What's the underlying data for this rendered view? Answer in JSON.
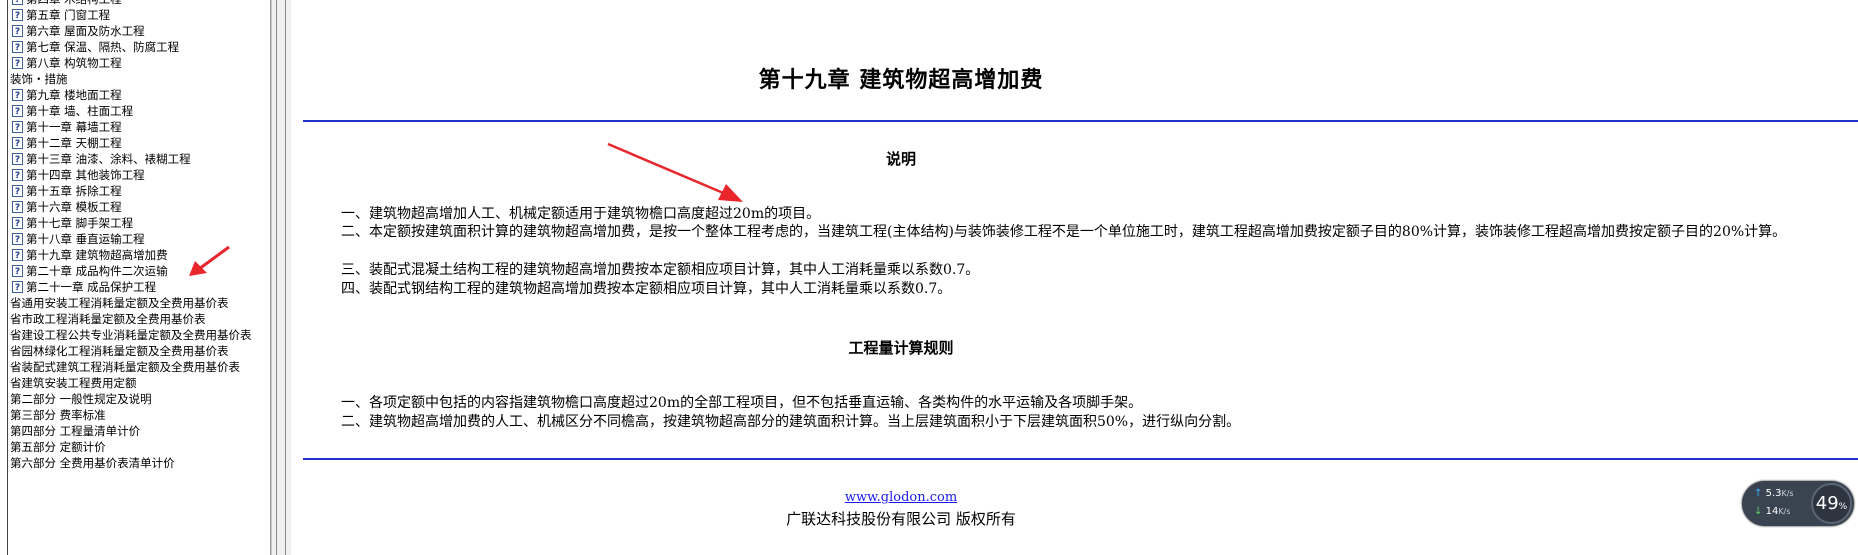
{
  "tree": [
    {
      "type": "doc",
      "label": "第四章  木结构工程"
    },
    {
      "type": "doc",
      "label": "第五章  门窗工程"
    },
    {
      "type": "doc",
      "label": "第六章  屋面及防水工程"
    },
    {
      "type": "doc",
      "label": "第七章  保温、隔热、防腐工程"
    },
    {
      "type": "doc",
      "label": "第八章  构筑物工程"
    },
    {
      "type": "cat",
      "label": "装饰・措施"
    },
    {
      "type": "doc",
      "label": "第九章  楼地面工程"
    },
    {
      "type": "doc",
      "label": "第十章  墙、柱面工程"
    },
    {
      "type": "doc",
      "label": "第十一章  幕墙工程"
    },
    {
      "type": "doc",
      "label": "第十二章  天棚工程"
    },
    {
      "type": "doc",
      "label": "第十三章  油漆、涂料、裱糊工程"
    },
    {
      "type": "doc",
      "label": "第十四章  其他装饰工程"
    },
    {
      "type": "doc",
      "label": "第十五章  拆除工程"
    },
    {
      "type": "doc",
      "label": "第十六章  模板工程"
    },
    {
      "type": "doc",
      "label": "第十七章  脚手架工程"
    },
    {
      "type": "doc",
      "label": "第十八章  垂直运输工程"
    },
    {
      "type": "doc",
      "label": "第十九章  建筑物超高增加费"
    },
    {
      "type": "doc",
      "label": "第二十章  成品构件二次运输"
    },
    {
      "type": "doc",
      "label": "第二十一章  成品保护工程"
    },
    {
      "type": "cat",
      "label": "省通用安装工程消耗量定额及全费用基价表"
    },
    {
      "type": "cat",
      "label": "省市政工程消耗量定额及全费用基价表"
    },
    {
      "type": "cat",
      "label": "省建设工程公共专业消耗量定额及全费用基价表"
    },
    {
      "type": "cat",
      "label": "省园林绿化工程消耗量定额及全费用基价表"
    },
    {
      "type": "cat",
      "label": "省装配式建筑工程消耗量定额及全费用基价表"
    },
    {
      "type": "cat",
      "label": "省建筑安装工程费用定额"
    },
    {
      "type": "cat",
      "label": "第二部分  一般性规定及说明"
    },
    {
      "type": "cat",
      "label": "第三部分  费率标准"
    },
    {
      "type": "cat",
      "label": "第四部分  工程量清单计价"
    },
    {
      "type": "cat",
      "label": "第五部分  定额计价"
    },
    {
      "type": "cat",
      "label": "第六部分  全费用基价表清单计价"
    }
  ],
  "content": {
    "title": "第十九章  建筑物超高增加费",
    "section1_heading": "说明",
    "section1_items": [
      "一、建筑物超高增加人工、机械定额适用于建筑物檐口高度超过20m的项目。",
      "二、本定额按建筑面积计算的建筑物超高增加费，是按一个整体工程考虑的，当建筑工程(主体结构)与装饰装修工程不是一个单位施工时，建筑工程超高增加费按定额子目的80%计算，装饰装修工程超高增加费按定额子目的20%计算。",
      "三、装配式混凝土结构工程的建筑物超高增加费按本定额相应项目计算，其中人工消耗量乘以系数0.7。",
      "四、装配式钢结构工程的建筑物超高增加费按本定额相应项目计算，其中人工消耗量乘以系数0.7。"
    ],
    "section2_heading": "工程量计算规则",
    "section2_items": [
      "一、各项定额中包括的内容指建筑物檐口高度超过20m的全部工程项目，但不包括垂直运输、各类构件的水平运输及各项脚手架。",
      "二、建筑物超高增加费的人工、机械区分不同檐高，按建筑物超高部分的建筑面积计算。当上层建筑面积小于下层建筑面积50%，进行纵向分割。"
    ]
  },
  "footer": {
    "link": "www.glodon.com",
    "copyright": "广联达科技股份有限公司  版权所有"
  },
  "net_widget": {
    "upload": "5.3",
    "upload_unit": "K/s",
    "download": "14",
    "download_unit": "K/s",
    "usage": "49",
    "usage_unit": "%"
  },
  "colors": {
    "rule": "#2233cc",
    "link": "#1a1aee",
    "arrow": "#e8262b"
  }
}
